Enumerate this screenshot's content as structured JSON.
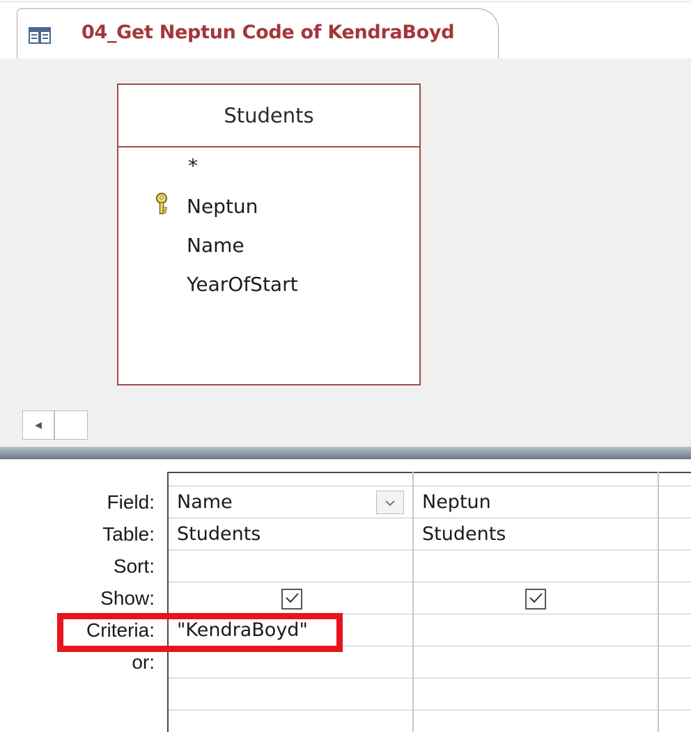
{
  "tab": {
    "title": "04_Get Neptun Code of KendraBoyd",
    "icon": "query-icon"
  },
  "table": {
    "name": "Students",
    "fields": [
      {
        "label": "*",
        "is_key": false
      },
      {
        "label": "Neptun",
        "is_key": true
      },
      {
        "label": "Name",
        "is_key": false
      },
      {
        "label": "YearOfStart",
        "is_key": false
      }
    ]
  },
  "grid": {
    "row_labels": {
      "field": "Field:",
      "table": "Table:",
      "sort": "Sort:",
      "show": "Show:",
      "criteria": "Criteria:",
      "or": "or:"
    },
    "columns": [
      {
        "field": "Name",
        "table": "Students",
        "sort": "",
        "show": true,
        "criteria": "\"KendraBoyd\"",
        "or": ""
      },
      {
        "field": "Neptun",
        "table": "Students",
        "sort": "",
        "show": true,
        "criteria": "",
        "or": ""
      }
    ]
  },
  "colors": {
    "tab_title": "#a4373a",
    "table_border": "#a34a4a",
    "highlight": "#e8141b"
  }
}
